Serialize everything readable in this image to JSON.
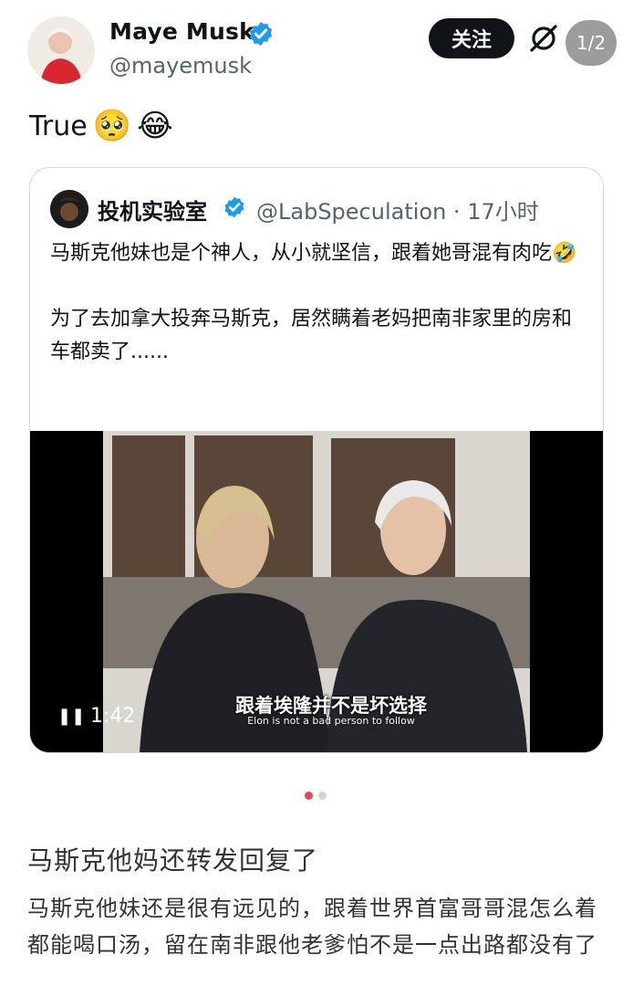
{
  "author": {
    "name": "Maye Musk",
    "handle": "@mayemusk"
  },
  "follow_label": "关注",
  "page_indicator": "1/2",
  "tweet_text": "True",
  "tweet_emojis": [
    "🥺",
    "😂"
  ],
  "quote": {
    "name": "投机实验室",
    "handle_time": "@LabSpeculation · 17小时",
    "paragraphs": [
      "马斯克他妹也是个神人，从小就坚信，跟着她哥混有肉吃🤣",
      "为了去加拿大投奔马斯克，居然瞒着老妈把南非家里的房和车都卖了......"
    ],
    "video": {
      "time": "1:42",
      "subtitle_zh": "跟着埃隆并不是坏选择",
      "subtitle_en": "Elon is not a bad person to follow"
    }
  },
  "article": {
    "title": "马斯克他妈还转发回复了",
    "body": "马斯克他妹还是很有远见的，跟着世界首富哥哥混怎么着都能喝口汤，留在南非跟他老爹怕不是一点出路都没有了"
  },
  "colors": {
    "verified": "#1d9bf0",
    "dot_active": "#e24a5a"
  }
}
